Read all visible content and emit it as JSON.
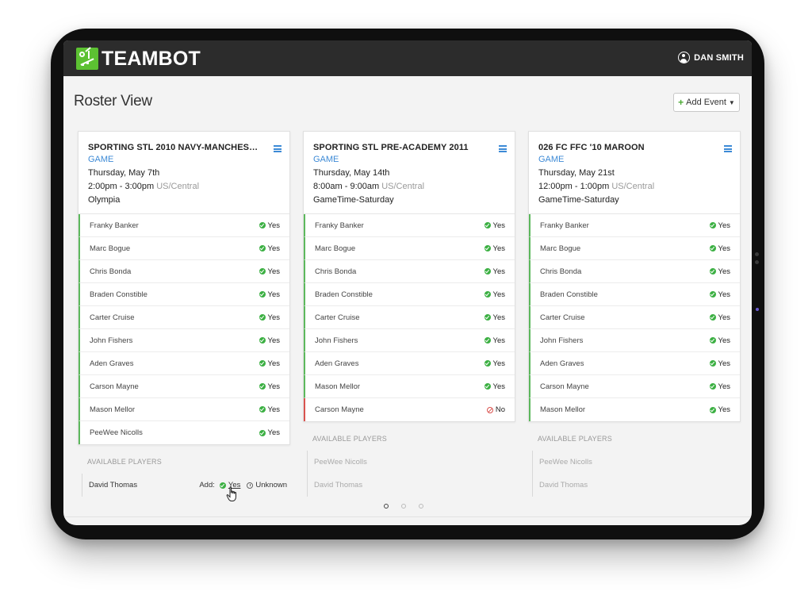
{
  "app": {
    "logo_text": "TEAMBOT",
    "user_name": "DAN SMITH"
  },
  "page": {
    "title": "Roster View",
    "add_event_label": "Add Event"
  },
  "events": [
    {
      "team": "SPORTING STL 2010 NAVY-MANCHESTE...",
      "type": "GAME",
      "date": "Thursday, May 7th",
      "time": "2:00pm - 3:00pm",
      "timezone": "US/Central",
      "location": "Olympia",
      "players": [
        {
          "name": "Franky Banker",
          "status": "Yes"
        },
        {
          "name": "Marc Bogue",
          "status": "Yes"
        },
        {
          "name": "Chris Bonda",
          "status": "Yes"
        },
        {
          "name": "Braden Constible",
          "status": "Yes"
        },
        {
          "name": "Carter Cruise",
          "status": "Yes"
        },
        {
          "name": "John Fishers",
          "status": "Yes"
        },
        {
          "name": "Aden Graves",
          "status": "Yes"
        },
        {
          "name": "Carson Mayne",
          "status": "Yes"
        },
        {
          "name": "Mason Mellor",
          "status": "Yes"
        },
        {
          "name": "PeeWee Nicolls",
          "status": "Yes"
        }
      ],
      "available_label": "AVAILABLE PLAYERS",
      "available": [
        {
          "name": "David Thomas"
        }
      ],
      "add_label": "Add:",
      "add_yes": "Yes",
      "add_unknown": "Unknown"
    },
    {
      "team": "SPORTING STL PRE-ACADEMY 2011",
      "type": "GAME",
      "date": "Thursday, May 14th",
      "time": "8:00am - 9:00am",
      "timezone": "US/Central",
      "location": "GameTime-Saturday",
      "players": [
        {
          "name": "Franky Banker",
          "status": "Yes"
        },
        {
          "name": "Marc Bogue",
          "status": "Yes"
        },
        {
          "name": "Chris Bonda",
          "status": "Yes"
        },
        {
          "name": "Braden Constible",
          "status": "Yes"
        },
        {
          "name": "Carter Cruise",
          "status": "Yes"
        },
        {
          "name": "John Fishers",
          "status": "Yes"
        },
        {
          "name": "Aden Graves",
          "status": "Yes"
        },
        {
          "name": "Mason Mellor",
          "status": "Yes"
        },
        {
          "name": "Carson Mayne",
          "status": "No"
        }
      ],
      "available_label": "AVAILABLE PLAYERS",
      "available": [
        {
          "name": "PeeWee Nicolls"
        },
        {
          "name": "David Thomas"
        }
      ]
    },
    {
      "team": "026 FC FFC '10 MAROON",
      "type": "GAME",
      "date": "Thursday, May 21st",
      "time": "12:00pm - 1:00pm",
      "timezone": "US/Central",
      "location": "GameTime-Saturday",
      "players": [
        {
          "name": "Franky Banker",
          "status": "Yes"
        },
        {
          "name": "Marc Bogue",
          "status": "Yes"
        },
        {
          "name": "Chris Bonda",
          "status": "Yes"
        },
        {
          "name": "Braden Constible",
          "status": "Yes"
        },
        {
          "name": "Carter Cruise",
          "status": "Yes"
        },
        {
          "name": "John Fishers",
          "status": "Yes"
        },
        {
          "name": "Aden Graves",
          "status": "Yes"
        },
        {
          "name": "Carson Mayne",
          "status": "Yes"
        },
        {
          "name": "Mason Mellor",
          "status": "Yes"
        }
      ],
      "available_label": "AVAILABLE PLAYERS",
      "available": [
        {
          "name": "PeeWee Nicolls"
        },
        {
          "name": "David Thomas"
        }
      ]
    }
  ],
  "pagination": {
    "pages": 3,
    "current": 1
  },
  "colors": {
    "brand_green": "#5cc132",
    "accent_blue": "#3d8ad6",
    "yes_green": "#3cb043",
    "no_red": "#d9534f"
  }
}
